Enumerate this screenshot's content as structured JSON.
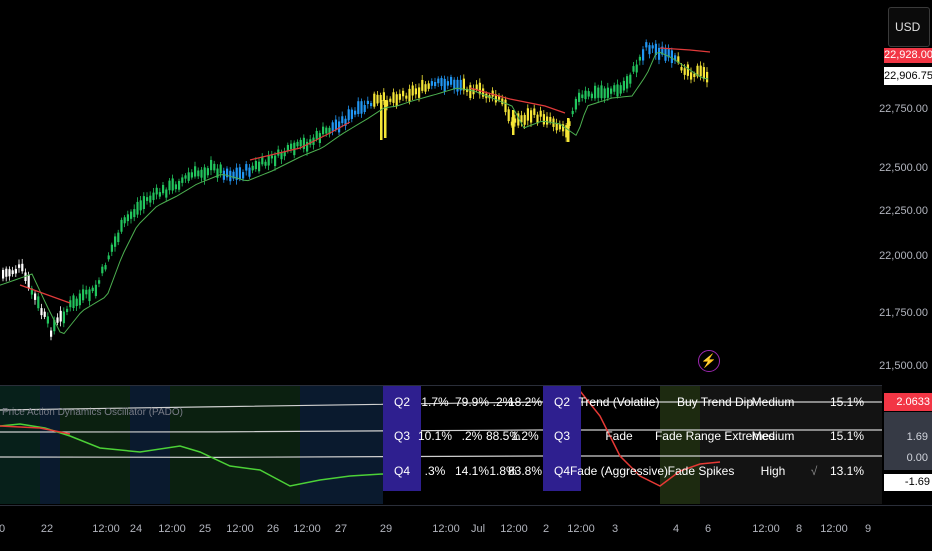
{
  "currency": "USD",
  "price_axis": {
    "labels": [
      "22,750.00",
      "22,500.00",
      "22,250.00",
      "22,000.00",
      "21,750.00",
      "21,500.00"
    ],
    "tag_top": "22,928.00",
    "tag_current": "22,906.75"
  },
  "oscillator": {
    "title": "Price Action Dynamics Oscillator (PADO)",
    "axis_labels": [
      "1.69",
      "0.00",
      "-1.69"
    ],
    "value_tag": "2.0633"
  },
  "x_axis": {
    "labels": [
      "0",
      "22",
      "12:00",
      "24",
      "12:00",
      "25",
      "12:00",
      "26",
      "12:00",
      "27",
      "29",
      "12:00",
      "Jul",
      "12:00",
      "2",
      "12:00",
      "3",
      "4",
      "6",
      "12:00",
      "8",
      "12:00",
      "9"
    ]
  },
  "table_left": {
    "rows": [
      {
        "q": "Q2",
        "a": "1.7%",
        "b": "79.9%",
        "c": ".2%",
        "d": "18.2%"
      },
      {
        "q": "Q3",
        "a": "10.1%",
        "b": ".2%",
        "c": "88.5%",
        "d": "1.2%"
      },
      {
        "q": "Q4",
        "a": ".3%",
        "b": "14.1%",
        "c": "1.8%",
        "d": "83.8%"
      }
    ]
  },
  "table_right": {
    "rows": [
      {
        "q": "Q2",
        "regime": "Trend (Volatile)",
        "action": "Buy Trend Dip",
        "risk": "Medium",
        "check": "",
        "pct": "15.1%"
      },
      {
        "q": "Q3",
        "regime": "Fade",
        "action": "Fade Range Extremes",
        "risk": "Medium",
        "check": "",
        "pct": "15.1%"
      },
      {
        "q": "Q4",
        "regime": "Fade (Aggressive)",
        "action": "Fade Spikes",
        "risk": "High",
        "check": "√",
        "pct": "13.1%"
      }
    ]
  },
  "lightning_icon": "⚡",
  "colors": {
    "up_green": "#22c55e",
    "up_blue": "#2196f3",
    "yellow": "#f5e637",
    "white_bar": "#ffffff",
    "ma_red": "#e03a3a",
    "ma_green": "#4caf50",
    "table_q_bg": "#2e1f8f",
    "tag_red": "#f23645"
  }
}
